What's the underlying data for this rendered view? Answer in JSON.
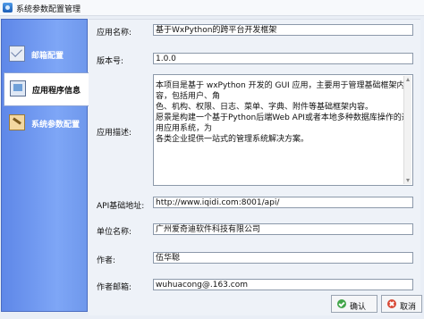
{
  "window": {
    "title": "系统参数配置管理"
  },
  "sidebar": {
    "items": [
      {
        "label": "邮箱配置",
        "icon": "mail-icon"
      },
      {
        "label": "应用程序信息",
        "icon": "app-info-icon"
      },
      {
        "label": "系统参数配置",
        "icon": "system-settings-icon"
      }
    ]
  },
  "form": {
    "app_name_label": "应用名称:",
    "app_name_value": "基于WxPython的跨平台开发框架",
    "version_label": "版本号:",
    "version_value": "1.0.0",
    "description_label": "应用描述:",
    "description_lines": [
      "本项目是基于 wxPython 开发的 GUI 应用，主要用于管理基础框架内容，包括用户、角",
      "色、机构、权限、日志、菜单、字典、附件等基础框架内容。",
      "愿景是构建一个基于Python后端Web API或者本地多种数据库操作的通用应用系统，为",
      "各类企业提供一站式的管理系统解决方案。"
    ],
    "api_label": "API基础地址:",
    "api_value": "http://www.iqidi.com:8001/api/",
    "company_label": "单位名称:",
    "company_value": "广州爱奇迪软件科技有限公司",
    "author_label": "作者:",
    "author_value": "伍华聪",
    "email_label": "作者邮箱:",
    "email_value": "wuhuacong@.163.com"
  },
  "buttons": {
    "ok": "确认",
    "cancel": "取消"
  },
  "colors": {
    "sidebar": "#6f98ec",
    "active_tab": "#ffffff",
    "ok_icon": "#42a54a",
    "cancel_icon": "#d84936"
  }
}
